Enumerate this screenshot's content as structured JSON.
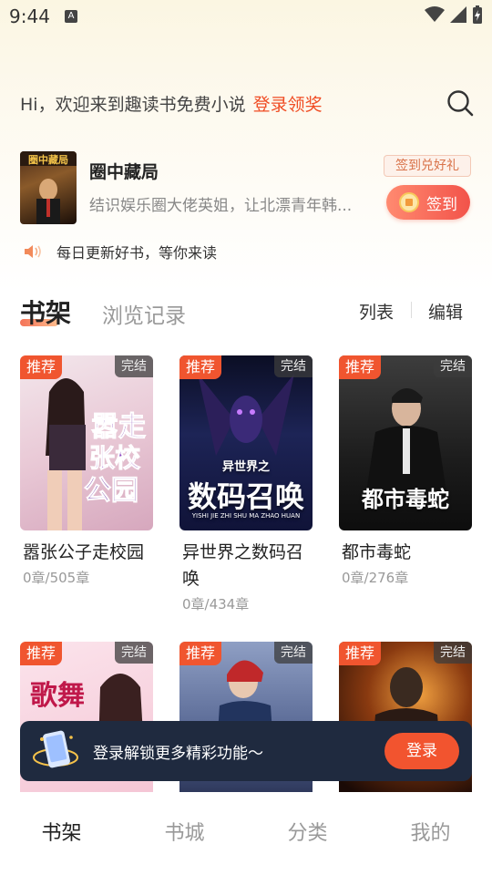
{
  "status_bar": {
    "time": "9:44",
    "notif_letter": "A"
  },
  "header": {
    "greeting": "Hi，欢迎来到趣读书免费小说",
    "login_link": "登录领奖"
  },
  "featured": {
    "title": "圈中藏局",
    "description": "结识娱乐圈大佬英姐，让北漂青年韩...",
    "gift_badge": "签到兑好礼",
    "signin_label": "签到"
  },
  "notice": {
    "text": "每日更新好书，等你来读"
  },
  "tabs": {
    "active": "书架",
    "inactive": "浏览记录",
    "list_label": "列表",
    "edit_label": "编辑"
  },
  "book_tags": {
    "recommend": "推荐",
    "completed": "完结"
  },
  "books": [
    {
      "title": "嚣张公子走校园",
      "progress": "0章/505章",
      "cover_text": "嚣张公子走校园"
    },
    {
      "title": "异世界之数码召唤",
      "progress": "0章/434章",
      "cover_text": "数码召唤",
      "cover_sub": "异世界之",
      "cover_small": "YISHI JIE ZHI SHU MA ZHAO HUAN"
    },
    {
      "title": "都市毒蛇",
      "progress": "0章/276章",
      "cover_text": "都市毒蛇"
    },
    {
      "title": "",
      "progress": "",
      "cover_text": "歌舞青"
    },
    {
      "title": "",
      "progress": "",
      "cover_text": ""
    },
    {
      "title": "",
      "progress": "",
      "cover_text": ""
    }
  ],
  "login_banner": {
    "text": "登录解锁更多精彩功能～",
    "button": "登录"
  },
  "bottom_nav": [
    "书架",
    "书城",
    "分类",
    "我的"
  ],
  "colors": {
    "accent": "#f04c23",
    "banner_bg": "#1f2a3f"
  }
}
